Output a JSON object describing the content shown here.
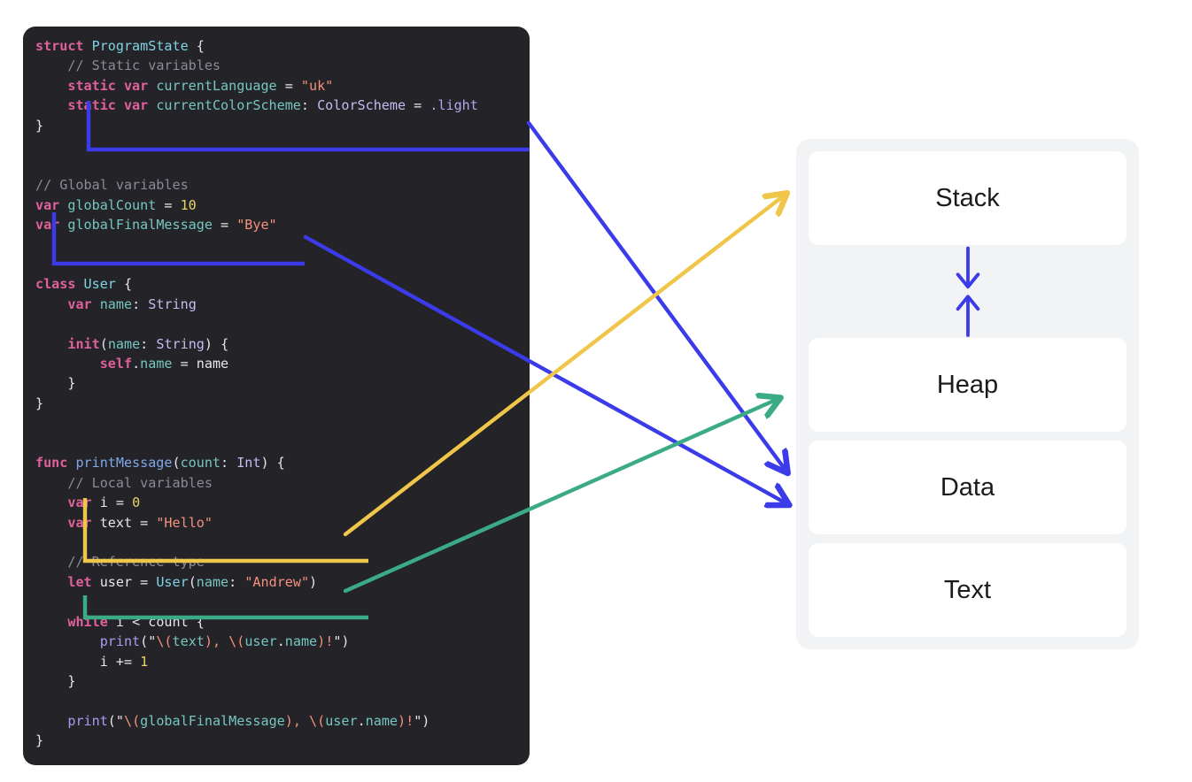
{
  "code": {
    "language": "swift",
    "lines": [
      [
        {
          "t": "struct ",
          "c": "kw"
        },
        {
          "t": "ProgramState",
          "c": "typ"
        },
        {
          "t": " {",
          "c": "pl"
        }
      ],
      [
        {
          "t": "    ",
          "c": "pl"
        },
        {
          "t": "// Static variables",
          "c": "cm"
        }
      ],
      [
        {
          "t": "    ",
          "c": "pl"
        },
        {
          "t": "static var ",
          "c": "kw"
        },
        {
          "t": "currentLanguage",
          "c": "id"
        },
        {
          "t": " = ",
          "c": "pl"
        },
        {
          "t": "\"uk\"",
          "c": "str"
        }
      ],
      [
        {
          "t": "    ",
          "c": "pl"
        },
        {
          "t": "static var ",
          "c": "kw"
        },
        {
          "t": "currentColorScheme",
          "c": "id"
        },
        {
          "t": ": ",
          "c": "pl"
        },
        {
          "t": "ColorScheme",
          "c": "typ2"
        },
        {
          "t": " = ",
          "c": "pl"
        },
        {
          "t": ".light",
          "c": "dot"
        }
      ],
      [
        {
          "t": "}",
          "c": "pl"
        }
      ],
      [
        {
          "t": "",
          "c": "pl"
        }
      ],
      [
        {
          "t": "",
          "c": "pl"
        }
      ],
      [
        {
          "t": "// Global variables",
          "c": "cm"
        }
      ],
      [
        {
          "t": "var ",
          "c": "kw"
        },
        {
          "t": "globalCount",
          "c": "id"
        },
        {
          "t": " = ",
          "c": "pl"
        },
        {
          "t": "10",
          "c": "num"
        }
      ],
      [
        {
          "t": "var ",
          "c": "kw"
        },
        {
          "t": "globalFinalMessage",
          "c": "id"
        },
        {
          "t": " = ",
          "c": "pl"
        },
        {
          "t": "\"Bye\"",
          "c": "str"
        }
      ],
      [
        {
          "t": "",
          "c": "pl"
        }
      ],
      [
        {
          "t": "",
          "c": "pl"
        }
      ],
      [
        {
          "t": "class ",
          "c": "kw"
        },
        {
          "t": "User",
          "c": "typ"
        },
        {
          "t": " {",
          "c": "pl"
        }
      ],
      [
        {
          "t": "    ",
          "c": "pl"
        },
        {
          "t": "var ",
          "c": "kw"
        },
        {
          "t": "name",
          "c": "id"
        },
        {
          "t": ": ",
          "c": "pl"
        },
        {
          "t": "String",
          "c": "typ2"
        }
      ],
      [
        {
          "t": "",
          "c": "pl"
        }
      ],
      [
        {
          "t": "    ",
          "c": "pl"
        },
        {
          "t": "init",
          "c": "kw"
        },
        {
          "t": "(",
          "c": "pl"
        },
        {
          "t": "name",
          "c": "id"
        },
        {
          "t": ": ",
          "c": "pl"
        },
        {
          "t": "String",
          "c": "typ2"
        },
        {
          "t": ") {",
          "c": "pl"
        }
      ],
      [
        {
          "t": "        ",
          "c": "pl"
        },
        {
          "t": "self",
          "c": "kw"
        },
        {
          "t": ".",
          "c": "pl"
        },
        {
          "t": "name",
          "c": "id"
        },
        {
          "t": " = name",
          "c": "pl"
        }
      ],
      [
        {
          "t": "    }",
          "c": "pl"
        }
      ],
      [
        {
          "t": "}",
          "c": "pl"
        }
      ],
      [
        {
          "t": "",
          "c": "pl"
        }
      ],
      [
        {
          "t": "",
          "c": "pl"
        }
      ],
      [
        {
          "t": "func ",
          "c": "kw"
        },
        {
          "t": "printMessage",
          "c": "fn"
        },
        {
          "t": "(",
          "c": "pl"
        },
        {
          "t": "count",
          "c": "id"
        },
        {
          "t": ": ",
          "c": "pl"
        },
        {
          "t": "Int",
          "c": "typ2"
        },
        {
          "t": ") {",
          "c": "pl"
        }
      ],
      [
        {
          "t": "    ",
          "c": "pl"
        },
        {
          "t": "// Local variables",
          "c": "cm"
        }
      ],
      [
        {
          "t": "    ",
          "c": "pl"
        },
        {
          "t": "var ",
          "c": "kw"
        },
        {
          "t": "i",
          "c": "pl"
        },
        {
          "t": " = ",
          "c": "pl"
        },
        {
          "t": "0",
          "c": "num"
        }
      ],
      [
        {
          "t": "    ",
          "c": "pl"
        },
        {
          "t": "var ",
          "c": "kw"
        },
        {
          "t": "text",
          "c": "pl"
        },
        {
          "t": " = ",
          "c": "pl"
        },
        {
          "t": "\"Hello\"",
          "c": "str"
        }
      ],
      [
        {
          "t": "",
          "c": "pl"
        }
      ],
      [
        {
          "t": "    ",
          "c": "pl"
        },
        {
          "t": "// Reference type",
          "c": "cm"
        }
      ],
      [
        {
          "t": "    ",
          "c": "pl"
        },
        {
          "t": "let ",
          "c": "kw"
        },
        {
          "t": "user",
          "c": "pl"
        },
        {
          "t": " = ",
          "c": "pl"
        },
        {
          "t": "User",
          "c": "typ"
        },
        {
          "t": "(",
          "c": "pl"
        },
        {
          "t": "name",
          "c": "id"
        },
        {
          "t": ": ",
          "c": "pl"
        },
        {
          "t": "\"Andrew\"",
          "c": "str"
        },
        {
          "t": ")",
          "c": "pl"
        }
      ],
      [
        {
          "t": "",
          "c": "pl"
        }
      ],
      [
        {
          "t": "    ",
          "c": "pl"
        },
        {
          "t": "while ",
          "c": "kw"
        },
        {
          "t": "i < count {",
          "c": "pl"
        }
      ],
      [
        {
          "t": "        ",
          "c": "pl"
        },
        {
          "t": "print",
          "c": "pr"
        },
        {
          "t": "(\"",
          "c": "pl"
        },
        {
          "t": "\\(",
          "c": "esc"
        },
        {
          "t": "text",
          "c": "id"
        },
        {
          "t": ")",
          "c": "esc"
        },
        {
          "t": ", ",
          "c": "str"
        },
        {
          "t": "\\(",
          "c": "esc"
        },
        {
          "t": "user",
          "c": "id"
        },
        {
          "t": ".",
          "c": "pl"
        },
        {
          "t": "name",
          "c": "id"
        },
        {
          "t": ")",
          "c": "esc"
        },
        {
          "t": "!",
          "c": "str"
        },
        {
          "t": "\")",
          "c": "pl"
        }
      ],
      [
        {
          "t": "        ",
          "c": "pl"
        },
        {
          "t": "i += ",
          "c": "pl"
        },
        {
          "t": "1",
          "c": "num"
        }
      ],
      [
        {
          "t": "    }",
          "c": "pl"
        }
      ],
      [
        {
          "t": "",
          "c": "pl"
        }
      ],
      [
        {
          "t": "    ",
          "c": "pl"
        },
        {
          "t": "print",
          "c": "pr"
        },
        {
          "t": "(\"",
          "c": "pl"
        },
        {
          "t": "\\(",
          "c": "esc"
        },
        {
          "t": "globalFinalMessage",
          "c": "id"
        },
        {
          "t": ")",
          "c": "esc"
        },
        {
          "t": ", ",
          "c": "str"
        },
        {
          "t": "\\(",
          "c": "esc"
        },
        {
          "t": "user",
          "c": "id"
        },
        {
          "t": ".",
          "c": "pl"
        },
        {
          "t": "name",
          "c": "id"
        },
        {
          "t": ")",
          "c": "esc"
        },
        {
          "t": "!",
          "c": "str"
        },
        {
          "t": "\")",
          "c": "pl"
        }
      ],
      [
        {
          "t": "}",
          "c": "pl"
        }
      ]
    ],
    "plain_text": "struct ProgramState {\n    // Static variables\n    static var currentLanguage = \"uk\"\n    static var currentColorScheme: ColorScheme = .light\n}\n\n\n// Global variables\nvar globalCount = 10\nvar globalFinalMessage = \"Bye\"\n\n\nclass User {\n    var name: String\n\n    init(name: String) {\n        self.name = name\n    }\n}\n\n\nfunc printMessage(count: Int) {\n    // Local variables\n    var i = 0\n    var text = \"Hello\"\n\n    // Reference type\n    let user = User(name: \"Andrew\")\n\n    while i < count {\n        print(\"\\(text), \\(user.name)!\")\n        i += 1\n    }\n\n    print(\"\\(globalFinalMessage), \\(user.name)!\")\n}"
  },
  "highlight_groups": [
    {
      "id": "static-variables",
      "label": "Static variables",
      "color": "#3b3bea",
      "target": "Data"
    },
    {
      "id": "global-variables",
      "label": "Global variables",
      "color": "#3b3bea",
      "target": "Data"
    },
    {
      "id": "local-variables",
      "label": "Local variables",
      "color": "#f0c64a",
      "target": "Stack"
    },
    {
      "id": "reference-type",
      "label": "Reference type",
      "color": "#3aab85",
      "target": "Heap"
    }
  ],
  "memory": {
    "segments": [
      {
        "id": "stack",
        "label": "Stack"
      },
      {
        "id": "heap",
        "label": "Heap"
      },
      {
        "id": "data",
        "label": "Data"
      },
      {
        "id": "text",
        "label": "Text"
      }
    ],
    "growth_arrows": [
      {
        "id": "stack-grows-down",
        "glyph": "↓",
        "direction": "down"
      },
      {
        "id": "heap-grows-up",
        "glyph": "↑",
        "direction": "up"
      }
    ],
    "panel_bg": "#f1f3f5",
    "box_bg": "#ffffff",
    "arrow_color": "#3b3bea"
  },
  "colors": {
    "code_bg": "#232328",
    "blue": "#3b3bea",
    "yellow": "#f0c64a",
    "green": "#3aab85"
  }
}
